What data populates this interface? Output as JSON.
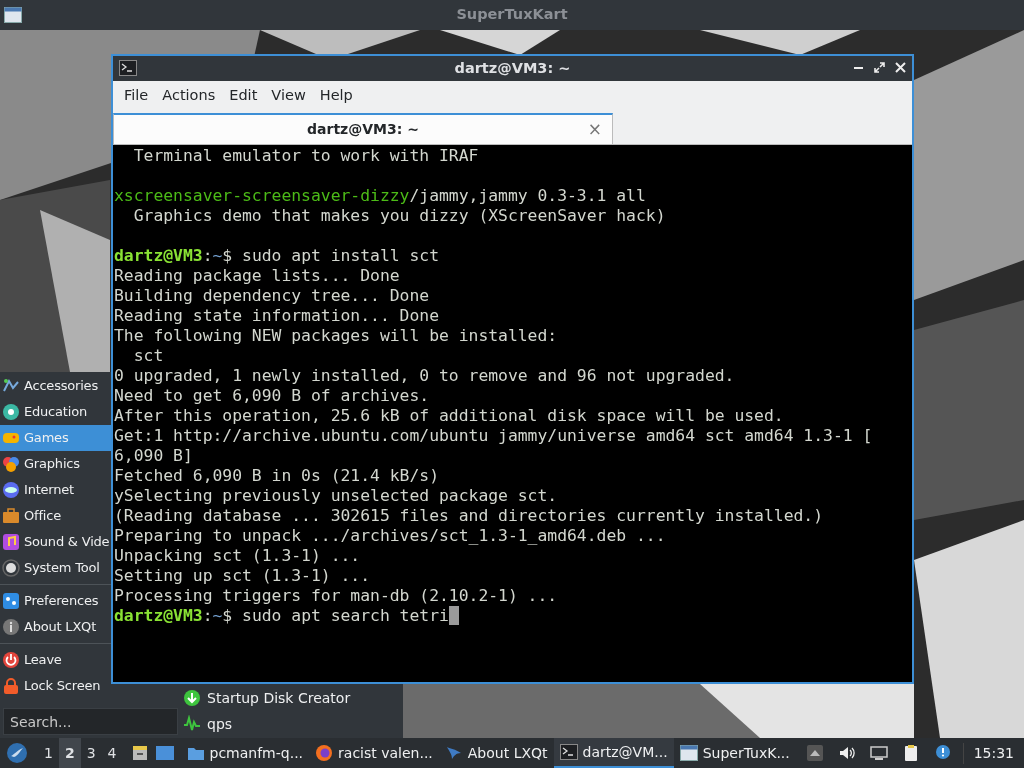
{
  "top_window": {
    "title": "SuperTuxKart"
  },
  "terminal": {
    "title": "dartz@VM3: ~",
    "menu": [
      "File",
      "Actions",
      "Edit",
      "View",
      "Help"
    ],
    "tabs": [
      {
        "label": "dartz@VM3: ~",
        "selected": true,
        "close": "×"
      }
    ],
    "lines": [
      {
        "segments": [
          {
            "kind": "text",
            "text": "  Terminal emulator to work with IRAF"
          }
        ]
      },
      {
        "gap_before": true,
        "segments": [
          {
            "kind": "package",
            "text": "xscreensaver-screensaver-dizzy"
          },
          {
            "kind": "text",
            "text": "/jammy,jammy 0.3-3.1 all"
          }
        ]
      },
      {
        "segments": [
          {
            "kind": "text",
            "text": "  Graphics demo that makes you dizzy (XScreenSaver hack)"
          }
        ]
      },
      {
        "gap_before": true,
        "segments": [
          {
            "kind": "user",
            "text": "dartz@VM3"
          },
          {
            "kind": "text",
            "text": ":"
          },
          {
            "kind": "path",
            "text": "~"
          },
          {
            "kind": "text",
            "text": "$ sudo apt install sct"
          }
        ]
      },
      {
        "segments": [
          {
            "kind": "text",
            "text": "Reading package lists... Done"
          }
        ]
      },
      {
        "segments": [
          {
            "kind": "text",
            "text": "Building dependency tree... Done"
          }
        ]
      },
      {
        "segments": [
          {
            "kind": "text",
            "text": "Reading state information... Done"
          }
        ]
      },
      {
        "segments": [
          {
            "kind": "text",
            "text": "The following NEW packages will be installed:"
          }
        ]
      },
      {
        "segments": [
          {
            "kind": "text",
            "text": "  sct"
          }
        ]
      },
      {
        "segments": [
          {
            "kind": "text",
            "text": "0 upgraded, 1 newly installed, 0 to remove and 96 not upgraded."
          }
        ]
      },
      {
        "segments": [
          {
            "kind": "text",
            "text": "Need to get 6,090 B of archives."
          }
        ]
      },
      {
        "segments": [
          {
            "kind": "text",
            "text": "After this operation, 25.6 kB of additional disk space will be used."
          }
        ]
      },
      {
        "segments": [
          {
            "kind": "text",
            "text": "Get:1 http://archive.ubuntu.com/ubuntu jammy/universe amd64 sct amd64 1.3-1 ["
          }
        ]
      },
      {
        "segments": [
          {
            "kind": "text",
            "text": "6,090 B]"
          }
        ]
      },
      {
        "segments": [
          {
            "kind": "text",
            "text": "Fetched 6,090 B in 0s (21.4 kB/s)"
          }
        ]
      },
      {
        "segments": [
          {
            "kind": "text",
            "text": "ySelecting previously unselected package sct."
          }
        ]
      },
      {
        "segments": [
          {
            "kind": "text",
            "text": "(Reading database ... 302615 files and directories currently installed.)"
          }
        ]
      },
      {
        "segments": [
          {
            "kind": "text",
            "text": "Preparing to unpack .../archives/sct_1.3-1_amd64.deb ..."
          }
        ]
      },
      {
        "segments": [
          {
            "kind": "text",
            "text": "Unpacking sct (1.3-1) ..."
          }
        ]
      },
      {
        "segments": [
          {
            "kind": "text",
            "text": "Setting up sct (1.3-1) ..."
          }
        ]
      },
      {
        "segments": [
          {
            "kind": "text",
            "text": "Processing triggers for man-db (2.10.2-1) ..."
          }
        ]
      },
      {
        "cursor": true,
        "segments": [
          {
            "kind": "user",
            "text": "dartz@VM3"
          },
          {
            "kind": "text",
            "text": ":"
          },
          {
            "kind": "path",
            "text": "~"
          },
          {
            "kind": "text",
            "text": "$ sudo apt search tetri"
          }
        ]
      }
    ]
  },
  "app_menu": {
    "items": [
      {
        "label": "Accessories",
        "selected": false
      },
      {
        "label": "Education",
        "selected": false
      },
      {
        "label": "Games",
        "selected": true
      },
      {
        "label": "Graphics",
        "selected": false
      },
      {
        "label": "Internet",
        "selected": false
      },
      {
        "label": "Office",
        "selected": false
      },
      {
        "label": "Sound & Vide",
        "selected": false
      },
      {
        "label": "System Tool",
        "selected": false
      },
      {
        "label": "Preferences",
        "selected": false,
        "separator_before": true
      },
      {
        "label": "About LXQt",
        "selected": false
      },
      {
        "label": "Leave",
        "selected": false,
        "separator_before": true
      },
      {
        "label": "Lock Screen",
        "selected": false
      }
    ],
    "search": {
      "placeholder": "Search..."
    }
  },
  "submenu": {
    "items": [
      {
        "label": "Startup Disk Creator"
      },
      {
        "label": "qps"
      }
    ]
  },
  "taskbar": {
    "desktops": [
      {
        "label": "1",
        "selected": false
      },
      {
        "label": "2",
        "selected": true
      },
      {
        "label": "3",
        "selected": false
      },
      {
        "label": "4",
        "selected": false
      }
    ],
    "tasks": [
      {
        "label": "pcmanfm-q...",
        "active": false
      },
      {
        "label": "racist valen...",
        "active": false
      },
      {
        "label": "About LXQt",
        "active": false
      },
      {
        "label": "dartz@VM...",
        "active": true
      },
      {
        "label": "SuperTuxK...",
        "active": false
      }
    ],
    "clock": "15:31"
  }
}
